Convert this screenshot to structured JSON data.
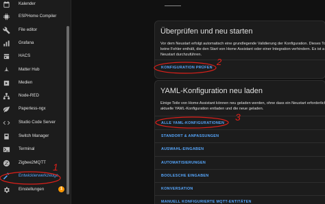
{
  "sidebar": {
    "items": [
      {
        "label": "Kalender",
        "icon": "calendar-icon"
      },
      {
        "label": "ESPHome Compiler",
        "icon": "chip-icon"
      },
      {
        "label": "File editor",
        "icon": "wrench-icon"
      },
      {
        "label": "Grafana",
        "icon": "chart-icon"
      },
      {
        "label": "HACS",
        "icon": "hacs-icon"
      },
      {
        "label": "Matter Hub",
        "icon": "hub-icon"
      },
      {
        "label": "Medien",
        "icon": "media-icon"
      },
      {
        "label": "Node-RED",
        "icon": "sitemap-icon"
      },
      {
        "label": "Paperless-ngx",
        "icon": "leaf-icon"
      },
      {
        "label": "Studio Code Server",
        "icon": "code-icon"
      },
      {
        "label": "Switch Manager",
        "icon": "switch-icon"
      },
      {
        "label": "Terminal",
        "icon": "terminal-icon"
      },
      {
        "label": "Zigbee2MQTT",
        "icon": "zigbee-icon"
      },
      {
        "label": "Entwicklerwerkzeuge",
        "icon": "hammer-icon",
        "active": true
      },
      {
        "label": "Einstellungen",
        "icon": "gear-icon",
        "badge": "1"
      }
    ]
  },
  "check_card": {
    "title": "Überprüfen und neu starten",
    "text_lines": [
      "Vor dem Neustart erfolgt automatisch eine grundlegende Validierung der Konfiguration. Dieses Tool",
      "keine Fehler enthält, die den Start von Home Assistant oder einer Integration verhindern. Es ist a",
      "Neustart durchzuführen."
    ],
    "action_label": "KONFIGURATION PRÜFEN"
  },
  "yaml_card": {
    "title": "YAML-Konfiguration neu laden",
    "text_lines": [
      "Einige Teile von Home Assistant können neu geladen werden, ohne dass ein Neustart erforderlich",
      "aktuelle YAML-Konfiguration entladen und die neue geladen."
    ],
    "actions": [
      "ALLE YAML-KONFIGURATIONEN",
      "STANDORT & ANPASSUNGEN",
      "AUSWAHL-EINGABEN",
      "AUTOMATISIERUNGEN",
      "BOOLESCHE EINGABEN",
      "KONVERSATION",
      "MANUELL KONFIGURIERTE MQTT-ENTITÄTEN"
    ]
  },
  "annotations": {
    "one": "1",
    "two": "2",
    "three": "3"
  },
  "colors": {
    "accent": "#57a8ff",
    "annotation": "#e0201a",
    "badge": "#ff9800"
  }
}
